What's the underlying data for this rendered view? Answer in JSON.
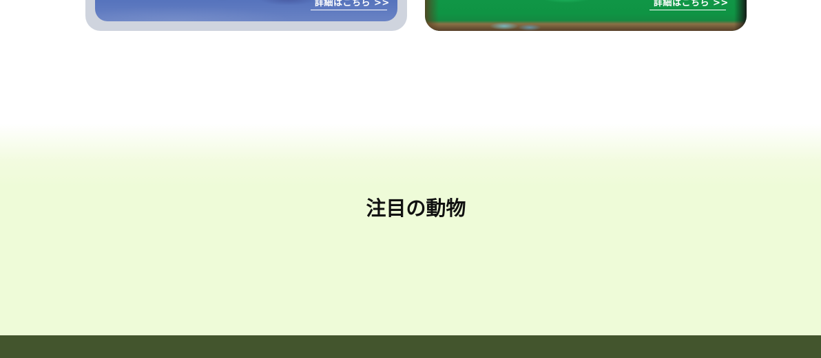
{
  "cards": [
    {
      "link_label": "詳細はこちら >>",
      "colors": {
        "frame": "#cfd4de",
        "overlay": "#5774bd"
      }
    },
    {
      "link_label": "詳細はこちら >>",
      "colors": {
        "frame": "#1b1b1b",
        "overlay": "#0f9444"
      }
    }
  ],
  "featured": {
    "title": "注目の動物",
    "colors": {
      "background": "#eefbd8",
      "title": "#111111"
    }
  },
  "footer": {
    "colors": {
      "background": "#43552d"
    }
  }
}
